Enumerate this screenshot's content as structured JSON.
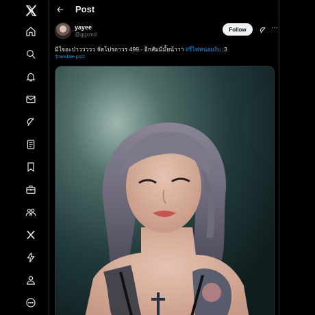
{
  "header": {
    "title": "Post"
  },
  "nav": {
    "items": [
      {
        "name": "x-logo-icon"
      },
      {
        "name": "home-icon"
      },
      {
        "name": "search-icon"
      },
      {
        "name": "notifications-icon"
      },
      {
        "name": "messages-icon"
      },
      {
        "name": "grok-icon"
      },
      {
        "name": "lists-icon"
      },
      {
        "name": "bookmarks-icon"
      },
      {
        "name": "jobs-icon"
      },
      {
        "name": "communities-icon"
      },
      {
        "name": "premium-x-icon"
      },
      {
        "name": "verified-orgs-icon"
      },
      {
        "name": "profile-icon"
      },
      {
        "name": "more-icon"
      }
    ]
  },
  "post": {
    "display_name": "yayee",
    "handle": "@ggxmd",
    "follow_label": "Follow",
    "text_main": "มีใจอะป่าววววว จัดโปรถาวร 499.- อีกสัมมีมั้ยน้าาา ",
    "hashtag": "#รีไฟหน่อยงับ",
    "text_end": " :3",
    "translate_label": "Translate post"
  },
  "colors": {
    "background": "#000000",
    "text": "#e7e9ea",
    "secondary_text": "#71767b",
    "accent": "#1d9bf0",
    "border": "#2f3336"
  }
}
